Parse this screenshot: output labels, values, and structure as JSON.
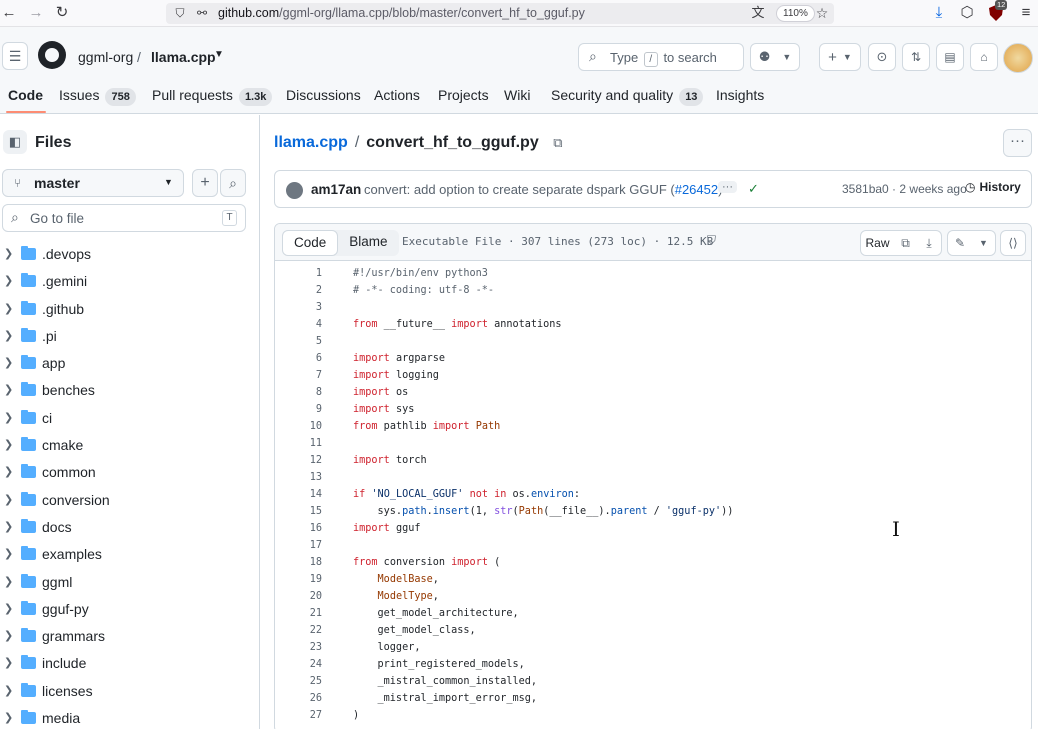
{
  "browser": {
    "url_host": "github.com",
    "url_path": "/ggml-org/llama.cpp/blob/master/convert_hf_to_gguf.py",
    "zoom": "110%",
    "ext_badge": "12"
  },
  "header": {
    "owner": "ggml-org",
    "repo": "llama.cpp",
    "search_prefix": "Type",
    "search_key": "/",
    "search_suffix": "to search"
  },
  "nav": {
    "code": "Code",
    "issues": "Issues",
    "issues_count": "758",
    "pulls": "Pull requests",
    "pulls_count": "1.3k",
    "discussions": "Discussions",
    "actions": "Actions",
    "projects": "Projects",
    "wiki": "Wiki",
    "security": "Security and quality",
    "security_count": "13",
    "insights": "Insights"
  },
  "sidebar": {
    "title": "Files",
    "branch": "master",
    "go_to_file": "Go to file",
    "go_to_file_key": "T",
    "items": [
      ".devops",
      ".gemini",
      ".github",
      ".pi",
      "app",
      "benches",
      "ci",
      "cmake",
      "common",
      "conversion",
      "docs",
      "examples",
      "ggml",
      "gguf-py",
      "grammars",
      "include",
      "licenses",
      "media"
    ]
  },
  "file": {
    "repo_link": "llama.cpp",
    "name": "convert_hf_to_gguf.py",
    "author": "am17an",
    "commit_message": "convert: add option to create separate dspark GGUF (",
    "commit_pr": "#26452",
    "commit_close": ")",
    "commit_hash": "3581ba0",
    "commit_age": "2 weeks ago",
    "history": "History",
    "tab_code": "Code",
    "tab_blame": "Blame",
    "info": "Executable File · 307 lines (273 loc) · 12.5 KB",
    "raw": "Raw"
  },
  "code_lines": [
    "1",
    "2",
    "3",
    "4",
    "5",
    "6",
    "7",
    "8",
    "9",
    "10",
    "11",
    "12",
    "13",
    "14",
    "15",
    "16",
    "17",
    "18",
    "19",
    "20",
    "21",
    "22",
    "23",
    "24",
    "25",
    "26",
    "27"
  ]
}
